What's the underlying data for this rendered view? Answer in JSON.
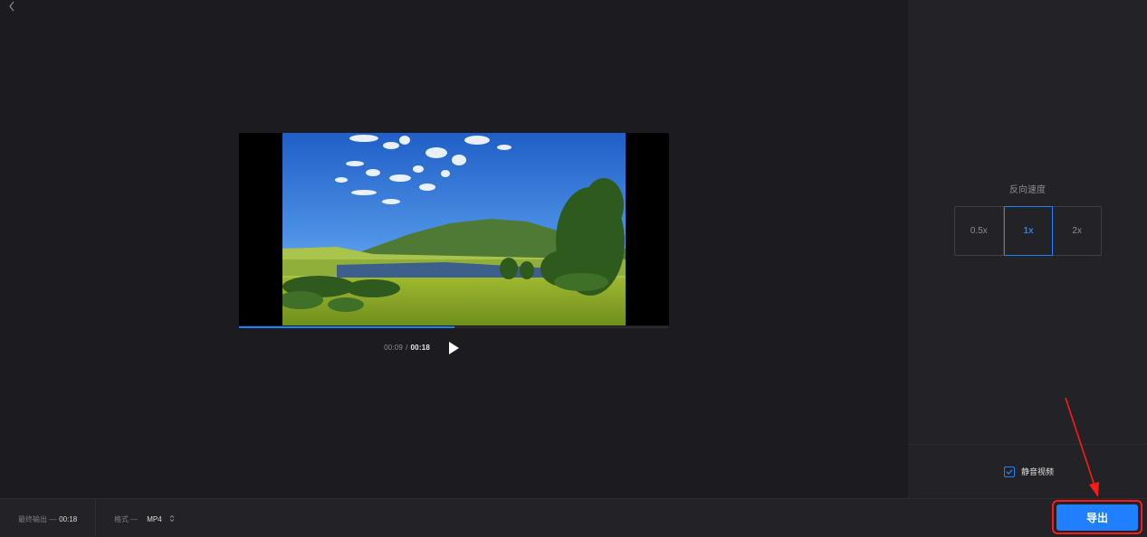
{
  "header": {
    "back_icon": "chevron-left-icon"
  },
  "player": {
    "current_time": "00:09",
    "separator": "/",
    "total_time": "00:18",
    "progress": 0.5,
    "play_icon": "play-icon"
  },
  "right_panel": {
    "speed_label": "反向速度",
    "speed_options": [
      "0.5x",
      "1x",
      "2x"
    ],
    "selected_speed": "1x",
    "mute_label": "静音视频",
    "mute_checked": true
  },
  "bottom_bar": {
    "output_label": "最终输出 —",
    "output_value": "00:18",
    "format_label": "格式 —",
    "format_value": "MP4",
    "format_select_icon": "updown-arrows-icon",
    "export_label": "导出"
  },
  "colors": {
    "accent": "#1e80ff",
    "annotation": "#ff1a1a",
    "background": "#1c1c20",
    "panel": "#232327"
  }
}
